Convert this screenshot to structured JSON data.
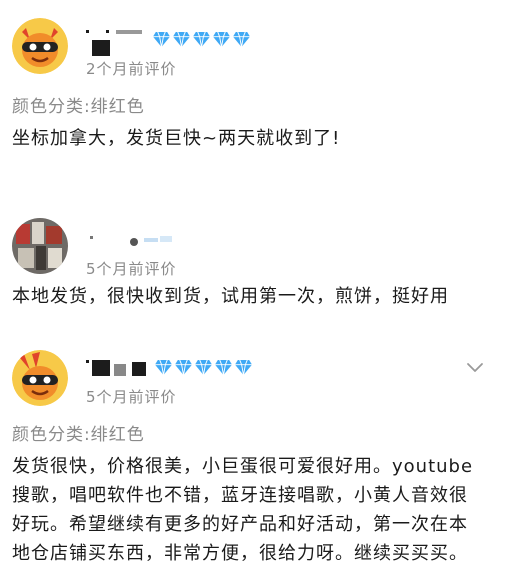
{
  "reviews": [
    {
      "username_visible": "",
      "level": "diamond x5",
      "time": "2个月前评价",
      "sku": "颜色分类:绯红色",
      "content": "坐标加拿大，发货巨快~两天就收到了!"
    },
    {
      "username_visible": "",
      "time": "5个月前评价",
      "content": "本地发货，很快收到货，试用第一次，煎饼，挺好用"
    },
    {
      "username_visible": "",
      "level": "diamond x5",
      "time": "5个月前评价",
      "sku": "颜色分类:绯红色",
      "content_lines": [
        "发货很快，价格很美，小巨蛋很可爱很好用。youtube",
        "搜歌，唱吧软件也不错，蓝牙连接唱歌，小黄人音效很",
        "好玩。希望继续有更多的好产品和好活动，第一次在本",
        "地仓店铺买东西，非常方便，很给力呀。继续买买买。"
      ]
    }
  ],
  "colors": {
    "diamond": "#3fa9f5",
    "text_primary": "#1a1a1a",
    "text_secondary": "#8a8a8a"
  },
  "icons": {
    "avatar_1": "minion-avatar-icon",
    "avatar_2": "photo-avatar",
    "avatar_3": "minion-avatar-icon",
    "more": "chevron-down-icon"
  }
}
